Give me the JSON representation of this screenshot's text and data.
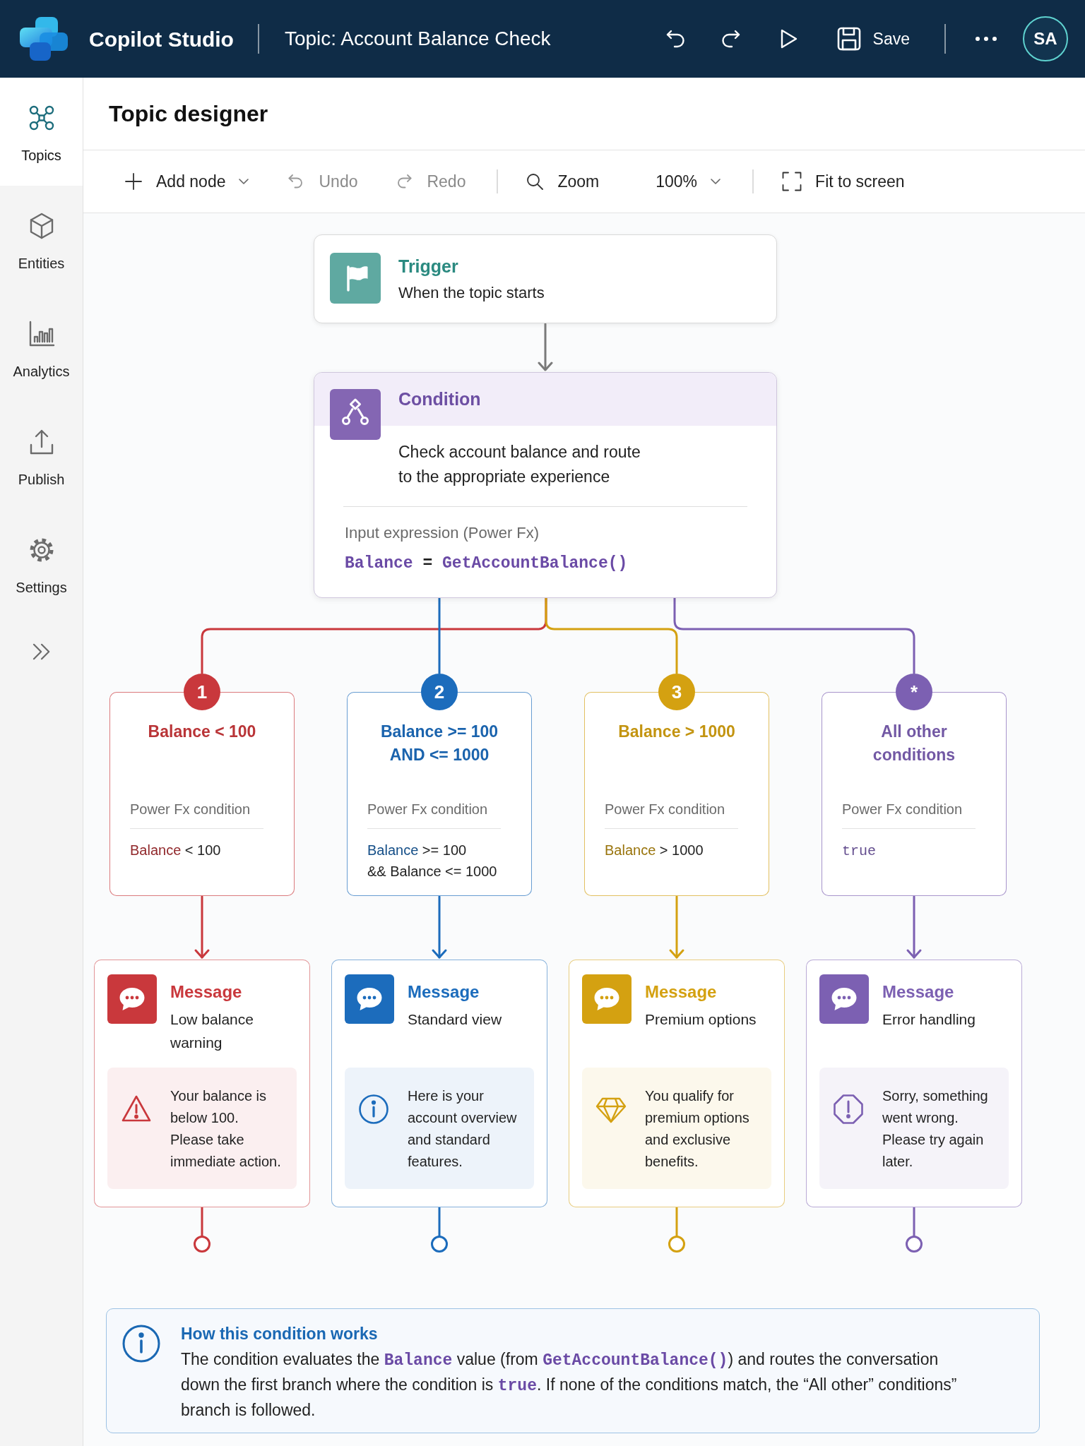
{
  "header": {
    "app_name": "Copilot Studio",
    "topic_title": "Topic: Account Balance Check",
    "save_label": "Save",
    "avatar_initials": "SA"
  },
  "sidebar": {
    "items": [
      {
        "label": "Topics",
        "selected": true
      },
      {
        "label": "Entities",
        "selected": false
      },
      {
        "label": "Analytics",
        "selected": false
      },
      {
        "label": "Publish",
        "selected": false
      },
      {
        "label": "Settings",
        "selected": false
      }
    ]
  },
  "page_title": "Topic designer",
  "toolbar": {
    "groups": [
      {
        "items": [
          {
            "kind": "menu",
            "label": "Add node",
            "disabled": false
          },
          {
            "kind": "button",
            "label": "Undo",
            "disabled": true
          },
          {
            "kind": "button",
            "label": "Redo",
            "disabled": true
          }
        ]
      },
      {
        "items": [
          {
            "kind": "button",
            "label": "Zoom",
            "disabled": false
          },
          {
            "kind": "select",
            "label": "100%",
            "disabled": false
          }
        ]
      },
      {
        "items": [
          {
            "kind": "button",
            "label": "Fit to screen",
            "disabled": false
          }
        ]
      }
    ]
  },
  "trigger": {
    "title": "Trigger",
    "description": "When the topic starts"
  },
  "condition": {
    "title": "Condition",
    "description": "Check account balance and route to the appropriate experience",
    "expression_label": "Input expression (Power Fx)",
    "expression": [
      {
        "kind": "variable",
        "text": "Balance"
      },
      {
        "kind": "operator",
        "text": " = "
      },
      {
        "kind": "function",
        "text": "GetAccountBalance()"
      }
    ]
  },
  "branches": [
    {
      "badge": "1",
      "color": "#c9383c",
      "title": "Balance < 100",
      "condition_label": "Power Fx condition",
      "condition": [
        [
          {
            "kind": "variable",
            "text": "Balance"
          },
          {
            "kind": "plain",
            "text": " < 100"
          }
        ]
      ],
      "message": {
        "title": "Message",
        "subtitle": "Low balance warning",
        "note": {
          "kind": "warning",
          "text": "Your balance is below 100. Please take immediate action."
        }
      }
    },
    {
      "badge": "2",
      "color": "#1c6cbc",
      "title": "Balance >= 100 AND <= 1000",
      "condition_label": "Power Fx condition",
      "condition": [
        [
          {
            "kind": "variable",
            "text": "Balance"
          },
          {
            "kind": "plain",
            "text": " >= 100"
          }
        ],
        [
          {
            "kind": "plain",
            "text": "&& Balance <= 1000"
          }
        ]
      ],
      "message": {
        "title": "Message",
        "subtitle": "Standard view",
        "note": {
          "kind": "info",
          "text": "Here is your account overview and standard features."
        }
      }
    },
    {
      "badge": "3",
      "color": "#d4a111",
      "title": "Balance > 1000",
      "condition_label": "Power Fx condition",
      "condition": [
        [
          {
            "kind": "variable",
            "text": "Balance"
          },
          {
            "kind": "plain",
            "text": " > 1000"
          }
        ]
      ],
      "message": {
        "title": "Message",
        "subtitle": "Premium options",
        "note": {
          "kind": "premium",
          "text": "You qualify for premium options and exclusive benefits."
        }
      }
    },
    {
      "badge": "*",
      "color": "#7c60b2",
      "title": "All other conditions",
      "condition_label": "Power Fx condition",
      "condition": [
        [
          {
            "kind": "keyword",
            "text": "true"
          }
        ]
      ],
      "message": {
        "title": "Message",
        "subtitle": "Error handling",
        "note": {
          "kind": "error",
          "text": "Sorry, something went wrong. Please try again later."
        }
      }
    }
  ],
  "info": {
    "title": "How this condition works",
    "text": "The condition evaluates the **Balance** value (from **GetAccountBalance()**) and routes the conversation down the first branch where the condition is **true**. If none of the conditions match, the “All other” conditions” branch is followed."
  }
}
